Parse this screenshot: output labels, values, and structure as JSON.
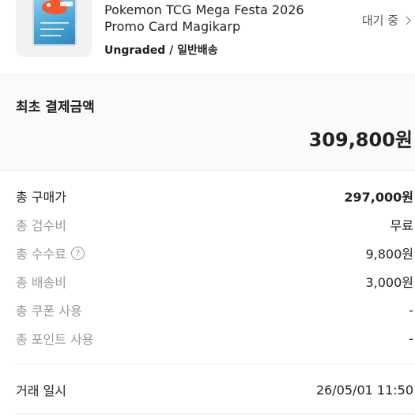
{
  "product": {
    "title": "Pokemon TCG Mega Festa 2026\nPromo Card Magikarp",
    "grade": "Ungraded / 일반배송",
    "status": "대기 중",
    "thumb_icon": "pokemon-card-thumbnail"
  },
  "summary": {
    "label": "최초 결제금액",
    "amount": "309,800원"
  },
  "breakdown": [
    {
      "label": "총 구매가",
      "value": "297,000원"
    },
    {
      "label": "총 검수비",
      "value": "무료"
    },
    {
      "label": "총 수수료",
      "value": "9,800원",
      "help_icon": "?"
    },
    {
      "label": "총 배송비",
      "value": "3,000원"
    },
    {
      "label": "총 쿠폰 사용",
      "value": "-"
    },
    {
      "label": "총 포인트 사용",
      "value": "-"
    }
  ],
  "deal": {
    "label": "거래 일시",
    "value": "26/05/01 11:50"
  },
  "colors": {
    "text": "#222222",
    "muted": "#9a9a9a",
    "section_bg": "#fafafa",
    "divider": "#eeeeee"
  }
}
